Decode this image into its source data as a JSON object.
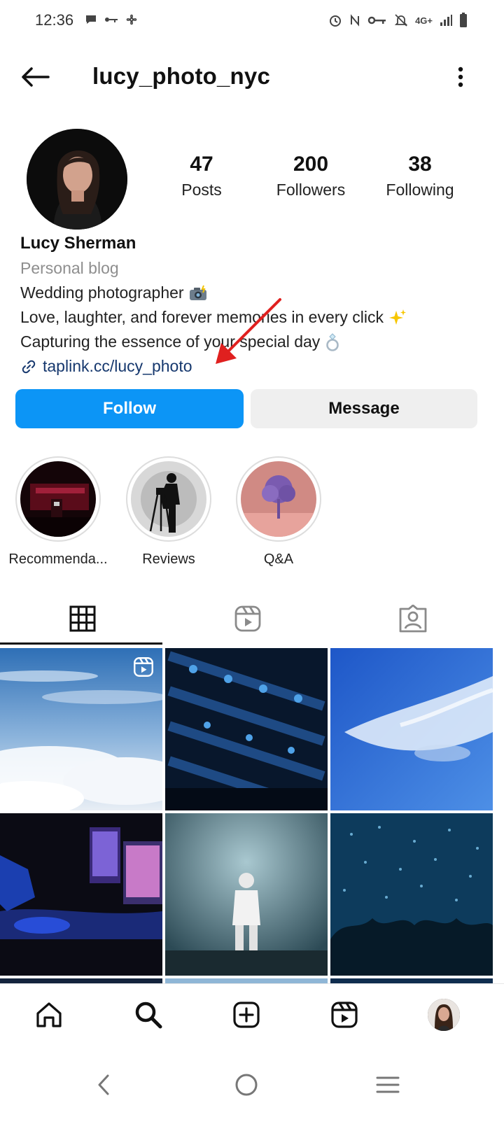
{
  "status_bar": {
    "time": "12:36",
    "network": "4G+",
    "left_icons": [
      "message-icon",
      "key-icon",
      "fan-icon"
    ],
    "right_icons": [
      "alarm-icon",
      "nfc-icon",
      "vpn-key-icon",
      "mute-icon",
      "signal-icon",
      "battery-icon"
    ]
  },
  "header": {
    "username": "lucy_photo_nyc",
    "back_icon": "arrow-left-icon",
    "more_icon": "more-vertical-icon"
  },
  "profile": {
    "stats": [
      {
        "value": "47",
        "label": "Posts"
      },
      {
        "value": "200",
        "label": "Followers"
      },
      {
        "value": "38",
        "label": "Following"
      }
    ],
    "name": "Lucy Sherman",
    "category": "Personal blog",
    "bio_lines": [
      {
        "text": "Wedding photographer",
        "emoji": "camera-flash-emoji"
      },
      {
        "text": "Love, laughter, and forever memories in every click",
        "emoji": "sparkles-emoji"
      },
      {
        "text": "Capturing the essence of your special day",
        "emoji": "ring-emoji"
      }
    ],
    "link": "taplink.cc/lucy_photo"
  },
  "actions": {
    "follow_label": "Follow",
    "message_label": "Message",
    "follow_color": "#0c95f6"
  },
  "highlights": [
    {
      "label": "Recommenda..."
    },
    {
      "label": "Reviews"
    },
    {
      "label": "Q&A"
    }
  ],
  "tabs": [
    {
      "name": "grid",
      "icon": "grid-icon",
      "active": true
    },
    {
      "name": "reels",
      "icon": "reels-icon",
      "active": false
    },
    {
      "name": "tagged",
      "icon": "tagged-person-icon",
      "active": false
    }
  ],
  "posts": [
    {
      "subject": "sky-clouds",
      "reel": true
    },
    {
      "subject": "mixing-console",
      "reel": false
    },
    {
      "subject": "blue-sky",
      "reel": false
    },
    {
      "subject": "dj-laptop",
      "reel": false
    },
    {
      "subject": "stage-performer",
      "reel": false
    },
    {
      "subject": "concert-crowd",
      "reel": false
    }
  ],
  "bottom_nav": [
    {
      "name": "home",
      "icon": "home-icon"
    },
    {
      "name": "search",
      "icon": "search-icon"
    },
    {
      "name": "create",
      "icon": "plus-square-icon"
    },
    {
      "name": "reels",
      "icon": "reels-icon"
    },
    {
      "name": "profile",
      "icon": "profile-avatar"
    }
  ],
  "system_nav": [
    "back-chevron-icon",
    "home-circle-icon",
    "recents-menu-icon"
  ],
  "annotation": {
    "color": "#e0201f"
  }
}
